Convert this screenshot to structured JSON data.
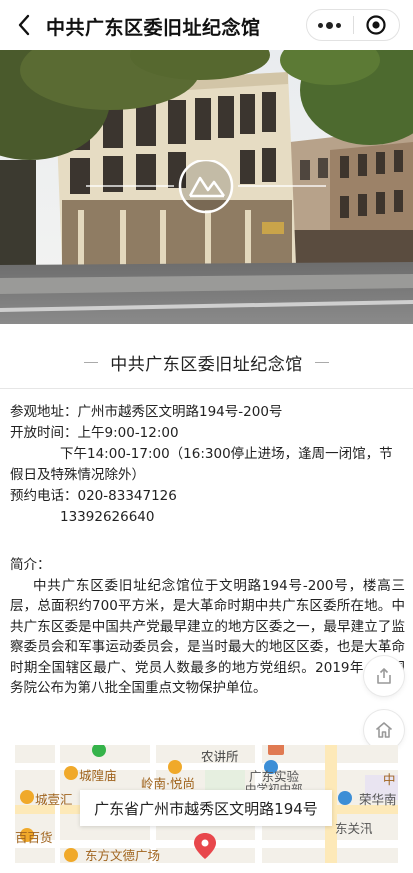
{
  "nav": {
    "title": "中共广东区委旧址纪念馆"
  },
  "section": {
    "title": "中共广东区委旧址纪念馆"
  },
  "info": {
    "address_label": "参观地址：",
    "address_value": "广州市越秀区文明路194号-200号",
    "hours_label": "开放时间：",
    "hours_am": "上午9:00-12:00",
    "hours_pm": "下午14:00-17:00（16:300停止进场，逢周一闭馆，节假日及特殊情况除外）",
    "phone_label": "预约电话：",
    "phone_1": "020-83347126",
    "phone_2": "13392626640"
  },
  "intro": {
    "heading": "简介：",
    "text": "中共广东区委旧址纪念馆位于文明路194号-200号，楼高三层，总面积约700平方米，是大革命时期中共广东区委所在地。中共广东区委是中国共产党最早建立的地方区委之一，最早建立了监察委员会和军事运动委员会，是当时最大的地区区委，也是大革命时期全国辖区最广、党员人数最多的地方党组织。2019年，被国务院公布为第八批全国重点文物保护单位。"
  },
  "map": {
    "address": "广东省广州市越秀区文明路194号",
    "labels": {
      "nongjiangsuo": "农讲所",
      "chenghuangmiao": "城隍庙",
      "lingnan": "岭南·悦尚",
      "guangdong_shiyan": "广东实验",
      "zhongxue": "中学初中部",
      "chengyijie": "城壹汇",
      "rongh": "荣华南",
      "baibaihuo": "百百货",
      "dongguan": "东关汛",
      "dongfang": "东方文德广场",
      "zhong_right": "中"
    },
    "accent_color": "#e8474c"
  },
  "colors": {
    "text": "#222222",
    "divider": "#e6e6e6"
  }
}
